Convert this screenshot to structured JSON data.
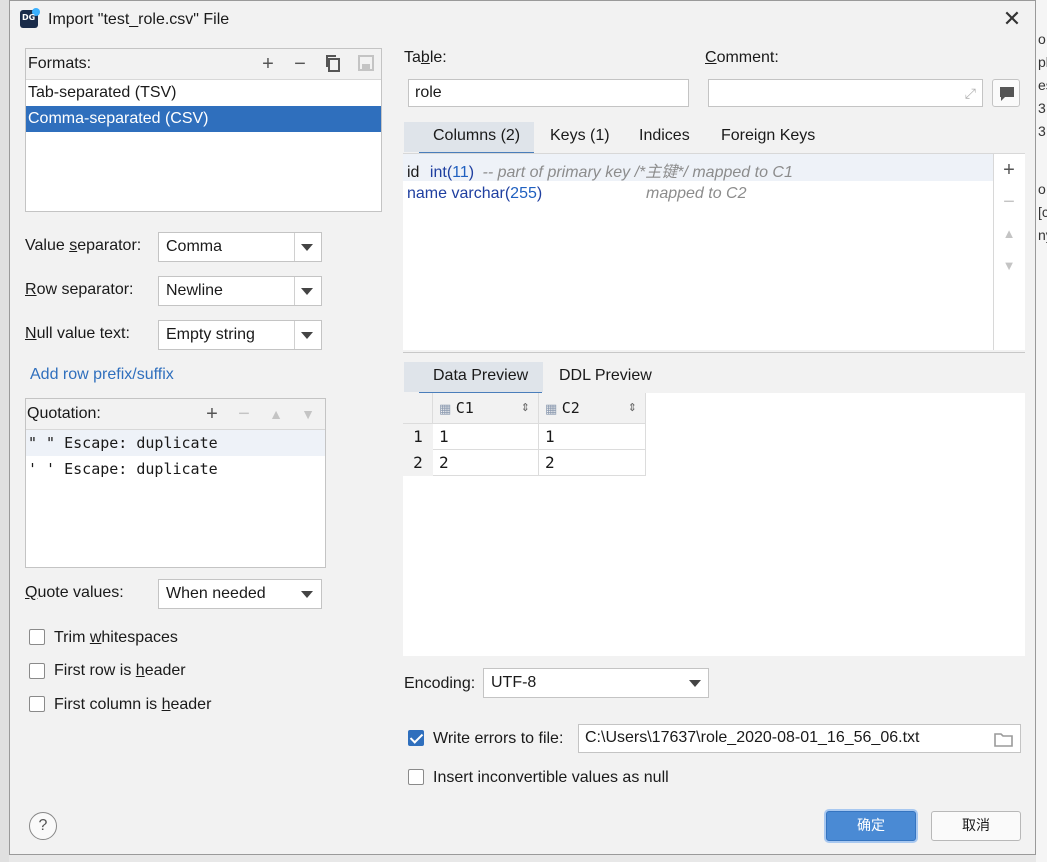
{
  "window": {
    "title": "Import \"test_role.csv\" File"
  },
  "formats": {
    "label": "Formats:",
    "items": [
      {
        "label": "Tab-separated (TSV)",
        "selected": false
      },
      {
        "label": "Comma-separated (CSV)",
        "selected": true
      }
    ]
  },
  "value_separator": {
    "label_pre": "Value ",
    "label_u": "s",
    "label_post": "eparator:",
    "value": "Comma"
  },
  "row_separator": {
    "label_pre": "",
    "label_u": "R",
    "label_post": "ow separator:",
    "value": "Newline"
  },
  "null_text": {
    "label_pre": "",
    "label_u": "N",
    "label_post": "ull value text:",
    "value": "Empty string"
  },
  "add_prefix_link": "Add row prefix/suffix",
  "quotation": {
    "label": "Quotation:",
    "items": [
      {
        "label": "\" \"  Escape: duplicate"
      },
      {
        "label": "' '  Escape: duplicate"
      }
    ]
  },
  "quote_values": {
    "label_pre": "",
    "label_u": "Q",
    "label_post": "uote values:",
    "value": "When needed"
  },
  "checkboxes": {
    "trim": {
      "pre": "Trim ",
      "u": "w",
      "post": "hitespaces",
      "checked": false
    },
    "first_row": {
      "pre": "First row is ",
      "u": "h",
      "post": "eader",
      "checked": false
    },
    "first_col": {
      "pre": "First column is ",
      "u": "h",
      "post": "eader",
      "checked": false
    }
  },
  "table": {
    "label_pre": "Ta",
    "label_u": "b",
    "label_post": "le:",
    "value": "role"
  },
  "comment": {
    "label_pre": "",
    "label_u": "C",
    "label_post": "omment:",
    "value": ""
  },
  "top_tabs": [
    "Columns (2)",
    "Keys (1)",
    "Indices",
    "Foreign Keys"
  ],
  "columns": [
    {
      "name": "id",
      "type": "int",
      "size": "11",
      "comment": "-- part of primary key /*主键*/ mapped to C1"
    },
    {
      "name": "name",
      "type": "varchar",
      "size": "255",
      "comment": "mapped to C2"
    }
  ],
  "preview_tabs": [
    "Data Preview",
    "DDL Preview"
  ],
  "preview": {
    "headers": [
      "C1",
      "C2"
    ],
    "rows": [
      {
        "num": "1",
        "cells": [
          "1",
          "1"
        ]
      },
      {
        "num": "2",
        "cells": [
          "2",
          "2"
        ]
      }
    ]
  },
  "encoding": {
    "label": "Encoding:",
    "value": "UTF-8"
  },
  "write_errors": {
    "label": "Write errors to file:",
    "checked": true,
    "path": "C:\\Users\\17637\\role_2020-08-01_16_56_06.txt"
  },
  "insert_null": {
    "label": "Insert inconvertible values as null",
    "checked": false
  },
  "buttons": {
    "ok": "确定",
    "cancel": "取消",
    "help": "?"
  },
  "background_right": [
    "o",
    "pl",
    "es",
    "3",
    "3",
    "o",
    "[c",
    "ny"
  ]
}
